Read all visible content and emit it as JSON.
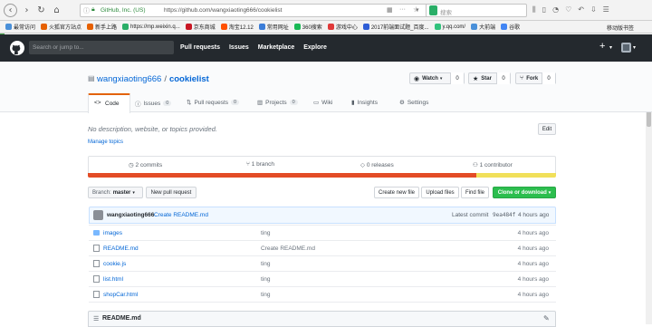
{
  "browser": {
    "site_identity": "GitHub, Inc. (US)",
    "url": "https://github.com/wangxiaoting666/cookielist",
    "search_placeholder": "搜索"
  },
  "bookmarks": [
    {
      "label": "最常访问",
      "color": "#4a90d9"
    },
    {
      "label": "火狐官方站点",
      "color": "#e66000"
    },
    {
      "label": "新手上路",
      "color": "#e66000"
    },
    {
      "label": "https://mp.weixin.q...",
      "color": "#2aae67"
    },
    {
      "label": "京东商城",
      "color": "#c81623"
    },
    {
      "label": "淘宝12.12",
      "color": "#ff5000"
    },
    {
      "label": "常用网址",
      "color": "#3b7dd8"
    },
    {
      "label": "360搜索",
      "color": "#19b955"
    },
    {
      "label": "游戏中心",
      "color": "#e03a3a"
    },
    {
      "label": "2017前端面试题_百度...",
      "color": "#2e5dd6"
    },
    {
      "label": "y.qq.com/",
      "color": "#31c27c"
    },
    {
      "label": "大前端",
      "color": "#4a90d9"
    },
    {
      "label": "谷歌",
      "color": "#4285f4"
    }
  ],
  "bookmarks_right": "移动版书签",
  "header": {
    "search_placeholder": "Search or jump to...",
    "nav": [
      "Pull requests",
      "Issues",
      "Marketplace",
      "Explore"
    ],
    "plus": "+"
  },
  "repo": {
    "owner": "wangxiaoting666",
    "separator": "/",
    "name": "cookielist",
    "watch_label": "Watch",
    "watch_count": "0",
    "star_label": "Star",
    "star_count": "0",
    "fork_label": "Fork",
    "fork_count": "0"
  },
  "tabs": {
    "code": "Code",
    "issues": "Issues",
    "issues_count": "0",
    "pulls": "Pull requests",
    "pulls_count": "0",
    "projects": "Projects",
    "projects_count": "0",
    "wiki": "Wiki",
    "insights": "Insights",
    "settings": "Settings"
  },
  "description": "No description, website, or topics provided.",
  "manage_topics": "Manage topics",
  "edit_label": "Edit",
  "summary": {
    "commits": "2 commits",
    "branches": "1 branch",
    "releases": "0 releases",
    "contributors": "1 contributor"
  },
  "lang_bar": [
    {
      "color": "#e34c26",
      "fraction": 0.83
    },
    {
      "color": "#f1e05a",
      "fraction": 0.17
    }
  ],
  "toolbar": {
    "branch_label": "Branch:",
    "branch_value": "master",
    "new_pr": "New pull request",
    "create_file": "Create new file",
    "upload": "Upload files",
    "find": "Find file",
    "clone": "Clone or download"
  },
  "commit": {
    "author": "wangxiaoting666",
    "message": "Create README.md",
    "latest_label": "Latest commit",
    "sha": "9ea484f",
    "age": "4 hours ago"
  },
  "files": [
    {
      "name": "images",
      "type": "folder",
      "message": "ting",
      "age": "4 hours ago"
    },
    {
      "name": "README.md",
      "type": "file",
      "message": "Create README.md",
      "age": "4 hours ago"
    },
    {
      "name": "cookie.js",
      "type": "file",
      "message": "ting",
      "age": "4 hours ago"
    },
    {
      "name": "list.html",
      "type": "file",
      "message": "ting",
      "age": "4 hours ago"
    },
    {
      "name": "shopCar.html",
      "type": "file",
      "message": "ting",
      "age": "4 hours ago"
    }
  ],
  "readme_title": "README.md"
}
